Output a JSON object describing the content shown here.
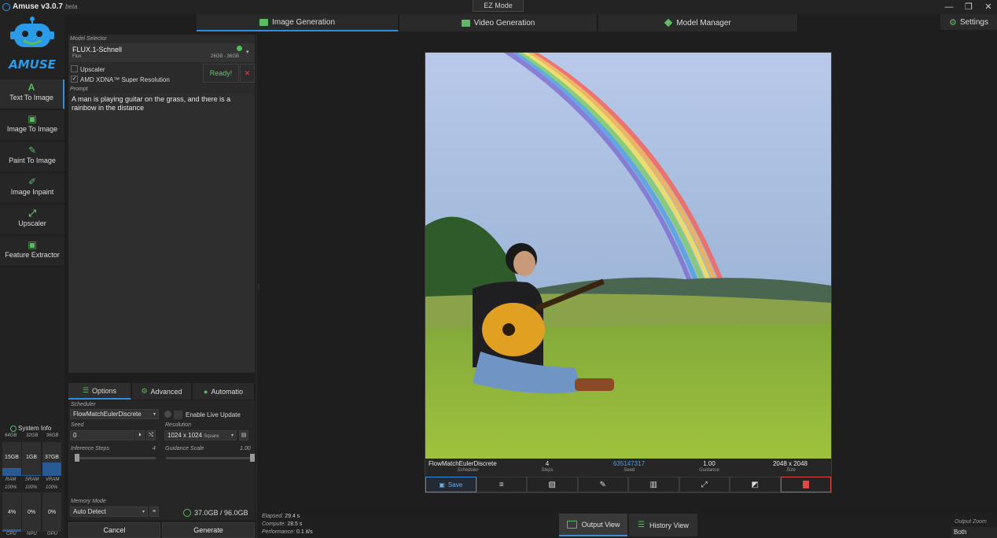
{
  "app": {
    "title": "Amuse v3.0.7",
    "tag": "beta",
    "ez_mode": "EZ Mode",
    "logo_text": "AMUSE"
  },
  "window_controls": {
    "minimize": "—",
    "restore": "❐",
    "close": "✕"
  },
  "main_tabs": [
    {
      "label": "Image Generation",
      "icon": "image-icon",
      "active": true
    },
    {
      "label": "Video Generation",
      "icon": "film-icon",
      "active": false
    },
    {
      "label": "Model Manager",
      "icon": "stack-icon",
      "active": false
    }
  ],
  "settings": {
    "label": "Settings"
  },
  "sidebar": {
    "items": [
      {
        "label": "Text To Image",
        "icon": "A",
        "active": true
      },
      {
        "label": "Image To Image",
        "icon": "▣",
        "active": false
      },
      {
        "label": "Paint To Image",
        "icon": "✎",
        "active": false
      },
      {
        "label": "Image Inpaint",
        "icon": "✐",
        "active": false
      },
      {
        "label": "Upscaler",
        "icon": "⤢",
        "active": false
      },
      {
        "label": "Feature Extractor",
        "icon": "▣",
        "active": false
      }
    ]
  },
  "system_info": {
    "title": "System Info",
    "capacities": [
      "64GB",
      "32GB",
      "96GB"
    ],
    "usage": [
      {
        "value": "15GB",
        "fill": 0.23,
        "label": "RAM",
        "pct": "100%"
      },
      {
        "value": "1GB",
        "fill": 0.03,
        "label": "SRAM",
        "pct": "100%"
      },
      {
        "value": "37GB",
        "fill": 0.39,
        "label": "VRAM",
        "pct": "100%"
      }
    ],
    "units": [
      {
        "value": "4%",
        "label": "CPU"
      },
      {
        "value": "0%",
        "label": "NPU"
      },
      {
        "value": "0%",
        "label": "GPU"
      }
    ]
  },
  "model_selector": {
    "label": "Model Selector",
    "name": "FLUX.1-Schnell",
    "family": "Flux",
    "size": "26GB - 36GB",
    "ready": "Ready!",
    "cancel": "✕"
  },
  "upscaler": {
    "label": "Upscaler",
    "checked": false
  },
  "super_res": {
    "label": "AMD XDNA™ Super Resolution",
    "checked": true
  },
  "prompt": {
    "label": "Prompt",
    "text": "A man is playing guitar on the grass, and there is a rainbow in the distance"
  },
  "option_tabs": [
    {
      "label": "Options",
      "active": true
    },
    {
      "label": "Advanced",
      "active": false
    },
    {
      "label": "Automatio",
      "active": false
    }
  ],
  "options": {
    "scheduler_label": "Scheduler",
    "scheduler": "FlowMatchEulerDiscrete",
    "live_update": "Enable Live Update",
    "seed_label": "Seed",
    "seed": "0",
    "resolution_label": "Resolution",
    "resolution": "1024 x 1024",
    "aspect": "Square",
    "steps_label": "Inference Steps",
    "steps": "4",
    "steps_fraction": 0.02,
    "guidance_label": "Guidance Scale",
    "guidance": "1.00",
    "guidance_fraction": 1.0,
    "memory_label": "Memory Mode",
    "memory": "Auto Detect",
    "memory_usage": "37.0GB / 96.0GB"
  },
  "actions": {
    "cancel": "Cancel",
    "generate": "Generate"
  },
  "result": {
    "scheduler": "FlowMatchEulerDiscrete",
    "scheduler_label": "Scheduler",
    "steps": "4",
    "steps_label": "Steps",
    "seed": "635147317",
    "seed_label": "Seed",
    "guidance": "1.00",
    "guidance_label": "Guidance",
    "size": "2048 x 2048",
    "size_label": "Size"
  },
  "toolbar": {
    "save": "Save"
  },
  "stats": {
    "elapsed_label": "Elapsed:",
    "elapsed": "29.4 s",
    "compute_label": "Compute:",
    "compute": "28.5 s",
    "performance_label": "Performance:",
    "performance": "0.1 it/s"
  },
  "views": {
    "output": "Output View",
    "history": "History View"
  },
  "zoom": {
    "label": "Output Zoom",
    "value": "Both"
  },
  "colors": {
    "accent": "#2e8fe0",
    "icon_green": "#5dbb63",
    "ready_green": "#5dcb63",
    "danger": "#e04848",
    "seed_blue": "#4a9fe8"
  }
}
